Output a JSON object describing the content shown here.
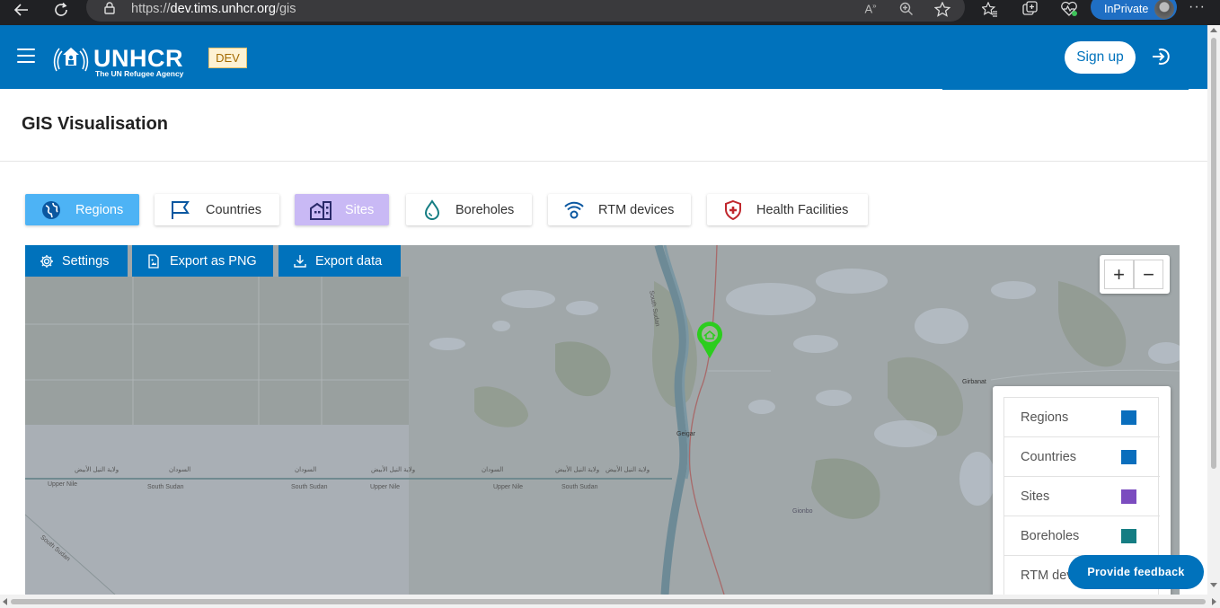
{
  "browser": {
    "url_scheme": "https://",
    "url_host": "dev.tims.unhcr.org",
    "url_path": "/gis",
    "inprivate_label": "InPrivate"
  },
  "header": {
    "logo_text": "UNHCR",
    "logo_subtitle": "The UN Refugee Agency",
    "env_badge": "DEV",
    "signup_label": "Sign up",
    "brand_color": "#0072bc"
  },
  "page": {
    "title": "GIS Visualisation"
  },
  "layers": [
    {
      "label": "Regions",
      "icon": "globe-icon",
      "active": true
    },
    {
      "label": "Countries",
      "icon": "flag-icon",
      "active": false
    },
    {
      "label": "Sites",
      "icon": "building-icon",
      "active": true
    },
    {
      "label": "Boreholes",
      "icon": "water-drop-icon",
      "active": false
    },
    {
      "label": "RTM devices",
      "icon": "signal-icon",
      "active": false
    },
    {
      "label": "Health Facilities",
      "icon": "health-shield-icon",
      "active": false
    }
  ],
  "map_toolbar": {
    "settings_label": "Settings",
    "export_png_label": "Export as PNG",
    "export_data_label": "Export data"
  },
  "map_labels": {
    "gaigar": "Geigar",
    "girbanat": "Girbanat",
    "upper_nile_1": "Upper Nile",
    "south_sudan_1": "South Sudan",
    "south_sudan_2": "South Sudan",
    "upper_nile_2": "Upper Nile",
    "upper_nile_3": "Upper Nile",
    "south_sudan_3": "South Sudan",
    "south_sudan_diag": "South Sudan",
    "south_sudan_vert": "South Sudan",
    "arabic_1": "ولاية النيل الأبيض",
    "arabic_2": "السودان",
    "arabic_3": "السودان",
    "arabic_4": "ولاية النيل الأبيض",
    "arabic_5": "السودان",
    "arabic_6": "ولاية النيل الأبيض",
    "arabic_7": "ولاية النيل الأبيض",
    "giondo": "Gionbo"
  },
  "zoom": {
    "in_label": "+",
    "out_label": "−"
  },
  "legend": [
    {
      "label": "Regions",
      "color": "#0a6ebd"
    },
    {
      "label": "Countries",
      "color": "#0a6ebd"
    },
    {
      "label": "Sites",
      "color": "#7b4cbf"
    },
    {
      "label": "Boreholes",
      "color": "#157d83"
    },
    {
      "label": "RTM devices",
      "color": "#1b9e77"
    }
  ],
  "feedback_label": "Provide feedback"
}
